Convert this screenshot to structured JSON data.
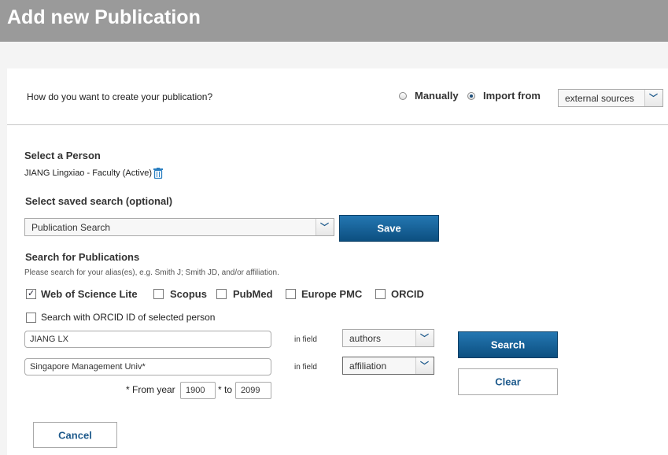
{
  "page": {
    "title": "Add new Publication"
  },
  "mode": {
    "question": "How do you want to create your publication?",
    "manual_label": "Manually",
    "import_label": "Import from",
    "source_value": "external sources"
  },
  "person": {
    "heading": "Select a Person",
    "name": "JIANG Lingxiao - Faculty (Active)"
  },
  "saved_search": {
    "heading": "Select saved search (optional)",
    "value": "Publication Search",
    "save_label": "Save"
  },
  "search": {
    "heading": "Search for Publications",
    "hint": "Please search for your alias(es), e.g. Smith J; Smith JD, and/or affiliation.",
    "sources": [
      {
        "label": "Web of Science Lite",
        "checked": true
      },
      {
        "label": "Scopus",
        "checked": false
      },
      {
        "label": "PubMed",
        "checked": false
      },
      {
        "label": "Europe PMC",
        "checked": false
      },
      {
        "label": "ORCID",
        "checked": false
      }
    ],
    "orcid_label": "Search with ORCID ID of selected person",
    "in_field_label": "in field",
    "term1": "JIANG LX",
    "field1": "authors",
    "term2": "Singapore Management Univ*",
    "field2": "affiliation",
    "from_year_label": "* From year",
    "from_year": "1900",
    "to_label": "* to",
    "to_year": "2099",
    "search_label": "Search",
    "clear_label": "Clear"
  },
  "footer": {
    "cancel_label": "Cancel"
  }
}
